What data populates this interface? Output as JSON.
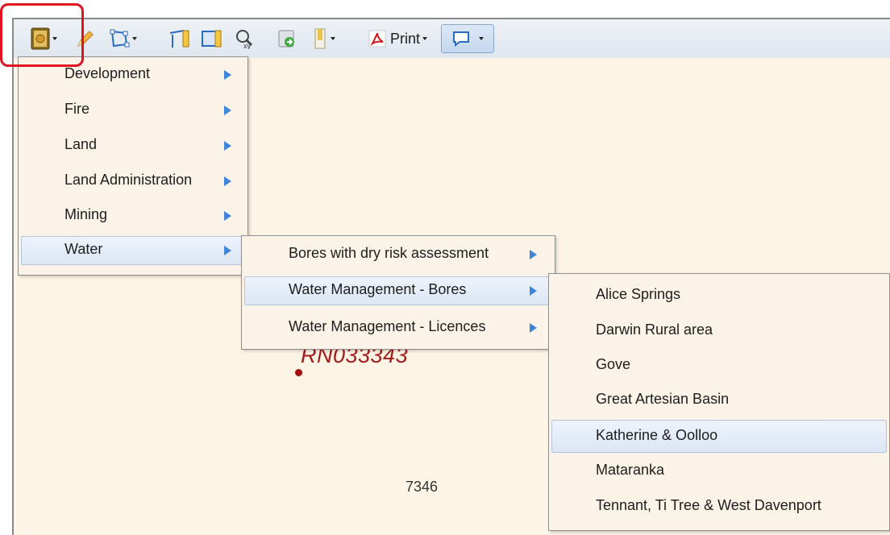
{
  "toolbar": {
    "print_label": "Print"
  },
  "map": {
    "feature_label": "RN033343",
    "grid_number": "7346"
  },
  "menu_level1": {
    "items": [
      {
        "label": "Development"
      },
      {
        "label": "Fire"
      },
      {
        "label": "Land"
      },
      {
        "label": "Land Administration"
      },
      {
        "label": "Mining"
      },
      {
        "label": "Water"
      }
    ]
  },
  "menu_level2": {
    "items": [
      {
        "label": "Bores with dry risk assessment"
      },
      {
        "label": "Water Management - Bores"
      },
      {
        "label": "Water Management - Licences"
      }
    ]
  },
  "menu_level3": {
    "items": [
      {
        "label": "Alice Springs"
      },
      {
        "label": "Darwin Rural area"
      },
      {
        "label": "Gove"
      },
      {
        "label": "Great Artesian Basin"
      },
      {
        "label": "Katherine & Oolloo"
      },
      {
        "label": "Mataranka"
      },
      {
        "label": "Tennant, Ti Tree & West Davenport"
      }
    ]
  },
  "colors": {
    "highlight": "#e0141e",
    "map_background": "#fef4e6",
    "menu_arrow": "#3e84d8",
    "feature_label": "#a31a1a"
  }
}
